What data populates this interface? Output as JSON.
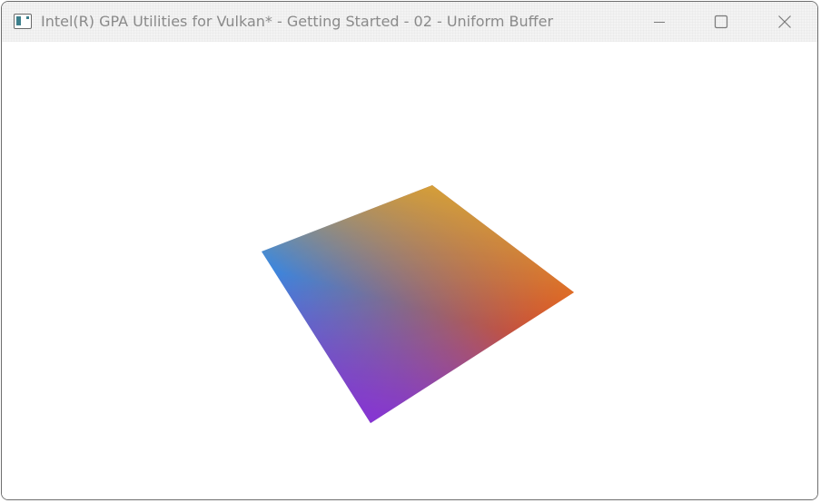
{
  "window": {
    "title": "Intel(R) GPA Utilities for Vulkan* - Getting Started - 02 - Uniform Buffer"
  },
  "titlebar": {
    "app_icon": "app-window-icon",
    "controls": {
      "minimize_icon": "minimize-icon",
      "maximize_icon": "maximize-icon",
      "close_icon": "close-icon"
    }
  },
  "scene": {
    "object": "rotated-quad",
    "corner_colors": {
      "left": "#2f8cf0",
      "top": "#e6a82a",
      "right": "#f0420e",
      "bottom": "#8a2ae0"
    },
    "background": "#ffffff"
  }
}
